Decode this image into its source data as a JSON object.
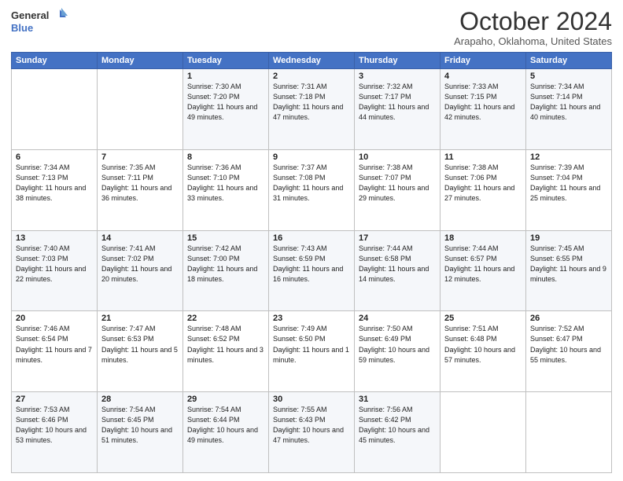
{
  "logo": {
    "line1": "General",
    "line2": "Blue"
  },
  "title": "October 2024",
  "location": "Arapaho, Oklahoma, United States",
  "weekdays": [
    "Sunday",
    "Monday",
    "Tuesday",
    "Wednesday",
    "Thursday",
    "Friday",
    "Saturday"
  ],
  "weeks": [
    [
      {
        "day": "",
        "info": ""
      },
      {
        "day": "",
        "info": ""
      },
      {
        "day": "1",
        "info": "Sunrise: 7:30 AM\nSunset: 7:20 PM\nDaylight: 11 hours and 49 minutes."
      },
      {
        "day": "2",
        "info": "Sunrise: 7:31 AM\nSunset: 7:18 PM\nDaylight: 11 hours and 47 minutes."
      },
      {
        "day": "3",
        "info": "Sunrise: 7:32 AM\nSunset: 7:17 PM\nDaylight: 11 hours and 44 minutes."
      },
      {
        "day": "4",
        "info": "Sunrise: 7:33 AM\nSunset: 7:15 PM\nDaylight: 11 hours and 42 minutes."
      },
      {
        "day": "5",
        "info": "Sunrise: 7:34 AM\nSunset: 7:14 PM\nDaylight: 11 hours and 40 minutes."
      }
    ],
    [
      {
        "day": "6",
        "info": "Sunrise: 7:34 AM\nSunset: 7:13 PM\nDaylight: 11 hours and 38 minutes."
      },
      {
        "day": "7",
        "info": "Sunrise: 7:35 AM\nSunset: 7:11 PM\nDaylight: 11 hours and 36 minutes."
      },
      {
        "day": "8",
        "info": "Sunrise: 7:36 AM\nSunset: 7:10 PM\nDaylight: 11 hours and 33 minutes."
      },
      {
        "day": "9",
        "info": "Sunrise: 7:37 AM\nSunset: 7:08 PM\nDaylight: 11 hours and 31 minutes."
      },
      {
        "day": "10",
        "info": "Sunrise: 7:38 AM\nSunset: 7:07 PM\nDaylight: 11 hours and 29 minutes."
      },
      {
        "day": "11",
        "info": "Sunrise: 7:38 AM\nSunset: 7:06 PM\nDaylight: 11 hours and 27 minutes."
      },
      {
        "day": "12",
        "info": "Sunrise: 7:39 AM\nSunset: 7:04 PM\nDaylight: 11 hours and 25 minutes."
      }
    ],
    [
      {
        "day": "13",
        "info": "Sunrise: 7:40 AM\nSunset: 7:03 PM\nDaylight: 11 hours and 22 minutes."
      },
      {
        "day": "14",
        "info": "Sunrise: 7:41 AM\nSunset: 7:02 PM\nDaylight: 11 hours and 20 minutes."
      },
      {
        "day": "15",
        "info": "Sunrise: 7:42 AM\nSunset: 7:00 PM\nDaylight: 11 hours and 18 minutes."
      },
      {
        "day": "16",
        "info": "Sunrise: 7:43 AM\nSunset: 6:59 PM\nDaylight: 11 hours and 16 minutes."
      },
      {
        "day": "17",
        "info": "Sunrise: 7:44 AM\nSunset: 6:58 PM\nDaylight: 11 hours and 14 minutes."
      },
      {
        "day": "18",
        "info": "Sunrise: 7:44 AM\nSunset: 6:57 PM\nDaylight: 11 hours and 12 minutes."
      },
      {
        "day": "19",
        "info": "Sunrise: 7:45 AM\nSunset: 6:55 PM\nDaylight: 11 hours and 9 minutes."
      }
    ],
    [
      {
        "day": "20",
        "info": "Sunrise: 7:46 AM\nSunset: 6:54 PM\nDaylight: 11 hours and 7 minutes."
      },
      {
        "day": "21",
        "info": "Sunrise: 7:47 AM\nSunset: 6:53 PM\nDaylight: 11 hours and 5 minutes."
      },
      {
        "day": "22",
        "info": "Sunrise: 7:48 AM\nSunset: 6:52 PM\nDaylight: 11 hours and 3 minutes."
      },
      {
        "day": "23",
        "info": "Sunrise: 7:49 AM\nSunset: 6:50 PM\nDaylight: 11 hours and 1 minute."
      },
      {
        "day": "24",
        "info": "Sunrise: 7:50 AM\nSunset: 6:49 PM\nDaylight: 10 hours and 59 minutes."
      },
      {
        "day": "25",
        "info": "Sunrise: 7:51 AM\nSunset: 6:48 PM\nDaylight: 10 hours and 57 minutes."
      },
      {
        "day": "26",
        "info": "Sunrise: 7:52 AM\nSunset: 6:47 PM\nDaylight: 10 hours and 55 minutes."
      }
    ],
    [
      {
        "day": "27",
        "info": "Sunrise: 7:53 AM\nSunset: 6:46 PM\nDaylight: 10 hours and 53 minutes."
      },
      {
        "day": "28",
        "info": "Sunrise: 7:54 AM\nSunset: 6:45 PM\nDaylight: 10 hours and 51 minutes."
      },
      {
        "day": "29",
        "info": "Sunrise: 7:54 AM\nSunset: 6:44 PM\nDaylight: 10 hours and 49 minutes."
      },
      {
        "day": "30",
        "info": "Sunrise: 7:55 AM\nSunset: 6:43 PM\nDaylight: 10 hours and 47 minutes."
      },
      {
        "day": "31",
        "info": "Sunrise: 7:56 AM\nSunset: 6:42 PM\nDaylight: 10 hours and 45 minutes."
      },
      {
        "day": "",
        "info": ""
      },
      {
        "day": "",
        "info": ""
      }
    ]
  ]
}
